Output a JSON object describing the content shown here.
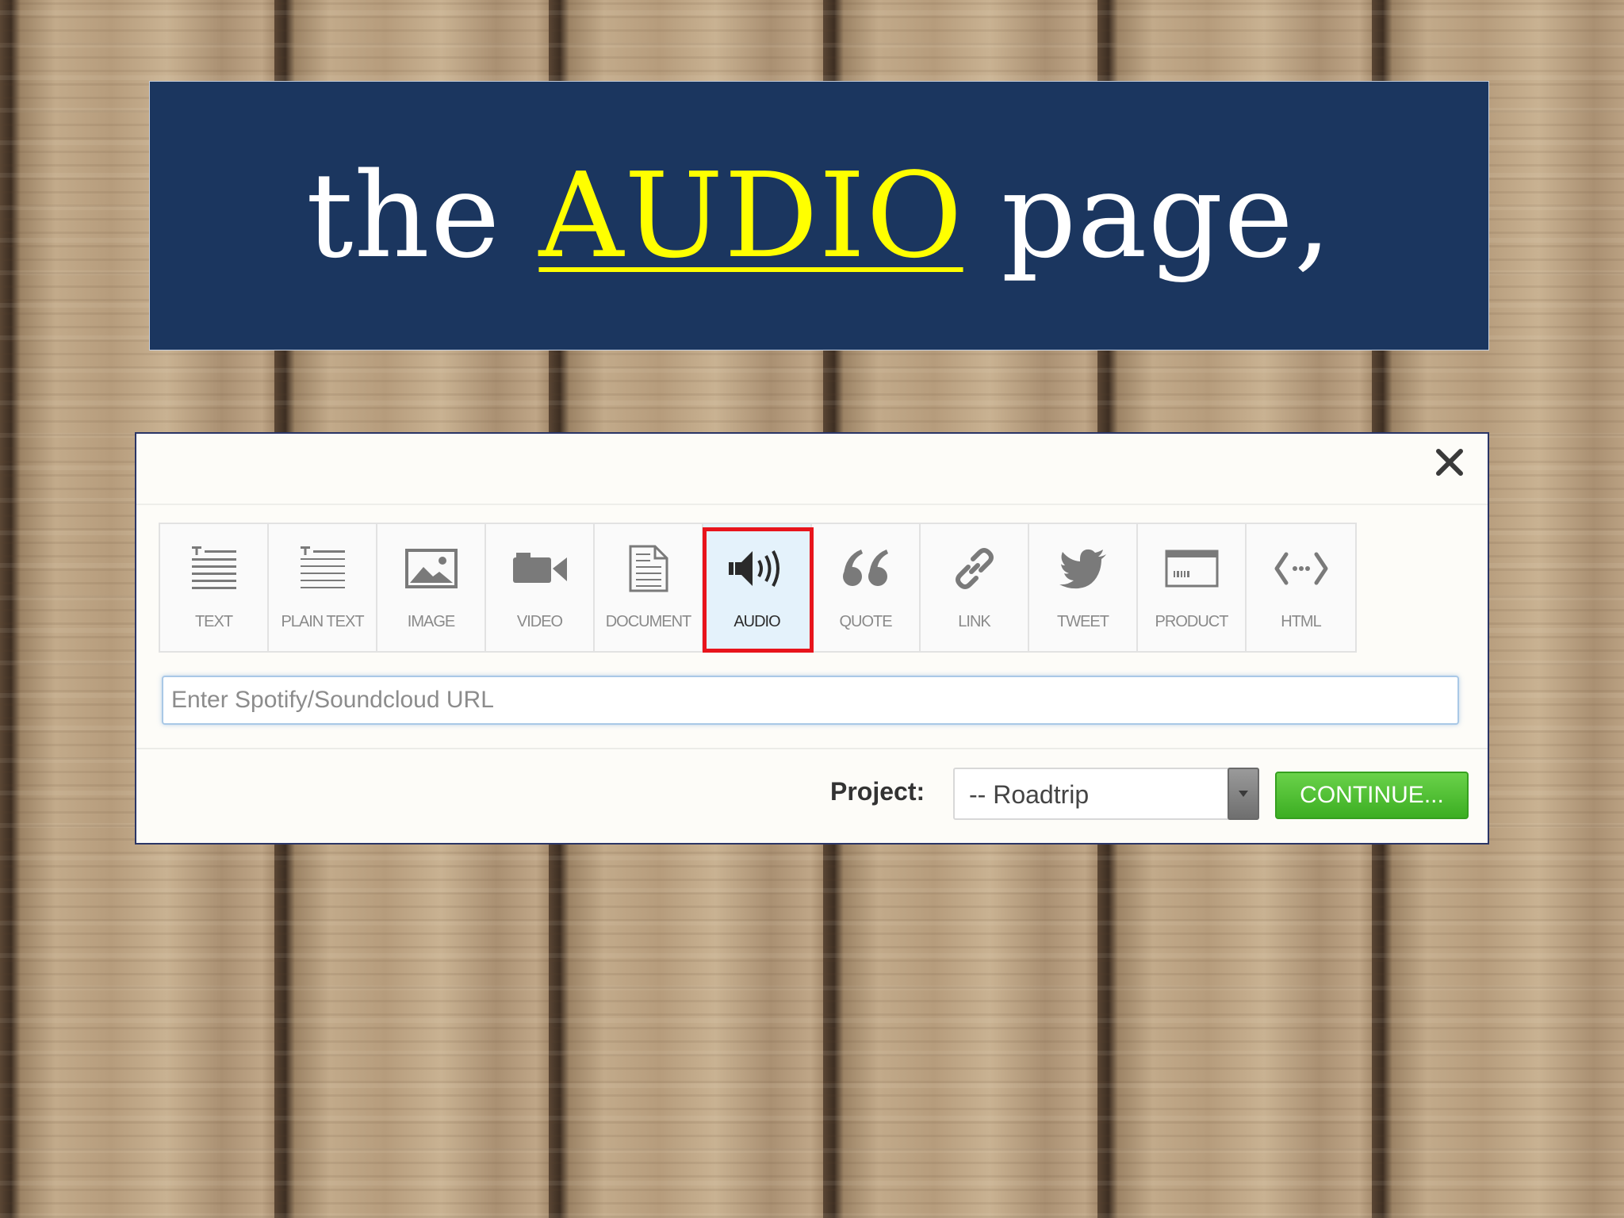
{
  "title": {
    "before": "the ",
    "accent": "AUDIO",
    "after": " page,",
    "accent_color": "#ffff00",
    "banner_color": "#1b365f"
  },
  "dialog": {
    "close_icon": "close-icon",
    "types": [
      {
        "label": "TEXT",
        "icon": "text-icon",
        "active": false
      },
      {
        "label": "PLAIN TEXT",
        "icon": "plain-text-icon",
        "active": false
      },
      {
        "label": "IMAGE",
        "icon": "image-icon",
        "active": false
      },
      {
        "label": "VIDEO",
        "icon": "video-camera-icon",
        "active": false
      },
      {
        "label": "DOCUMENT",
        "icon": "document-icon",
        "active": false
      },
      {
        "label": "AUDIO",
        "icon": "speaker-icon",
        "active": true
      },
      {
        "label": "QUOTE",
        "icon": "quote-icon",
        "active": false
      },
      {
        "label": "LINK",
        "icon": "link-icon",
        "active": false
      },
      {
        "label": "TWEET",
        "icon": "bird-icon",
        "active": false
      },
      {
        "label": "PRODUCT",
        "icon": "product-icon",
        "active": false
      },
      {
        "label": "HTML",
        "icon": "code-icon",
        "active": false
      }
    ],
    "highlight_color": "#e8141c",
    "url_input": {
      "placeholder": "Enter Spotify/Soundcloud URL",
      "value": ""
    },
    "footer": {
      "project_label": "Project:",
      "project_value": "-- Roadtrip",
      "continue_label": "CONTINUE...",
      "continue_color": "#3cae22"
    }
  }
}
